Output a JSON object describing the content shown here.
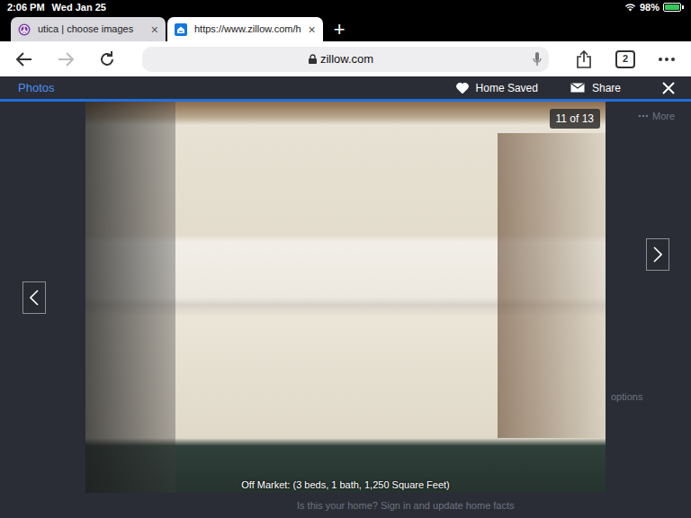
{
  "status_bar": {
    "time": "2:06 PM",
    "date": "Wed Jan 25",
    "battery": "98%",
    "battery_level": 0.98
  },
  "browser": {
    "tabs": [
      {
        "label": "utica | choose images",
        "selected": false,
        "close": "×"
      },
      {
        "label": "https://www.zillow.com/h",
        "selected": true,
        "close": "×"
      }
    ],
    "new_tab": "+",
    "address": "zillow.com",
    "tab_count": "2",
    "forward_enabled": false
  },
  "viewer": {
    "section": "Photos",
    "saved_label": "Home Saved",
    "saved": true,
    "share": "Share",
    "counter": "11 of 13",
    "caption": "Off Market: (3 beds, 1 bath, 1,250 Square Feet)"
  },
  "behind": {
    "menu": "More",
    "link": "options",
    "footer": "Is this your home? Sign in and update home facts"
  }
}
